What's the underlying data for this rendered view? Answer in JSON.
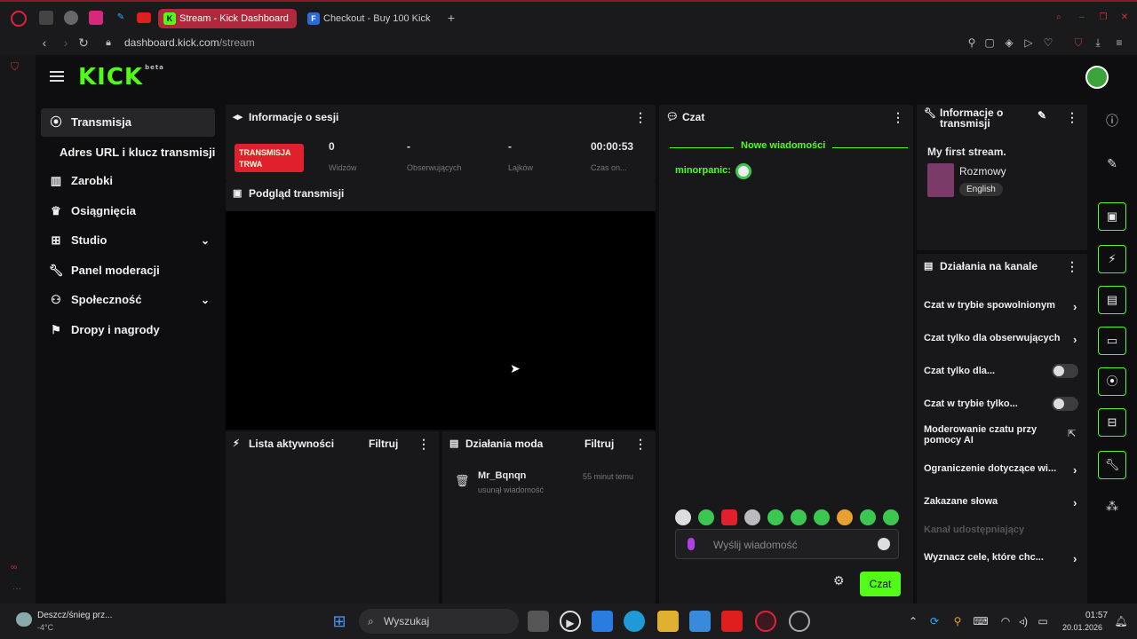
{
  "browser": {
    "tabs": [
      {
        "title": "Stream - Kick Dashboard",
        "active": true
      },
      {
        "title": "Checkout - Buy 100 Kick",
        "active": false
      }
    ],
    "url_host": "dashboard.kick.com",
    "url_path": "/stream"
  },
  "brand": {
    "logo": "KICK",
    "logo_sup": "beta",
    "accent": "#53fc18"
  },
  "sidebar": {
    "items": [
      {
        "label": "Transmisja",
        "icon": "broadcast-icon",
        "active": true
      },
      {
        "label": "Zarobki",
        "icon": "chart-icon"
      },
      {
        "label": "Osiągnięcia",
        "icon": "trophy-icon"
      },
      {
        "label": "Studio",
        "icon": "studio-icon",
        "expandable": true
      },
      {
        "label": "Panel moderacji",
        "icon": "wrench-icon"
      },
      {
        "label": "Społeczność",
        "icon": "community-icon",
        "expandable": true
      },
      {
        "label": "Dropy i nagrody",
        "icon": "gift-icon"
      }
    ],
    "sub_item": "Adres URL i klucz transmisji"
  },
  "session": {
    "title": "Informacje o sesji",
    "badge": "TRANSMISJA TRWA",
    "stats": [
      {
        "value": "0",
        "label": "Widzów"
      },
      {
        "value": "-",
        "label": "Obserwujących"
      },
      {
        "value": "-",
        "label": "Lajków"
      },
      {
        "value": "00:00:53",
        "label": "Czas on..."
      }
    ]
  },
  "preview": {
    "title": "Podgląd transmisji"
  },
  "activity": {
    "title": "Lista aktywności",
    "filter": "Filtruj"
  },
  "mod": {
    "title": "Działania moda",
    "filter": "Filtruj",
    "entry_user": "Mr_Bqnqn",
    "entry_action": "usunął wiadomość",
    "entry_time": "55 minut temu"
  },
  "chat": {
    "title": "Czat",
    "new_messages": "Nowe wiadomości",
    "user": "minorpanic:",
    "input_placeholder": "Wyślij wiadomość",
    "send": "Czat"
  },
  "stream_info": {
    "title": "Informacje o transmisji",
    "stream_title": "My first stream.",
    "category": "Rozmowy",
    "language": "English"
  },
  "channel_actions": {
    "title": "Działania na kanale",
    "items": [
      {
        "label": "Czat w trybie spowolnionym",
        "kind": "arrow"
      },
      {
        "label": "Czat tylko dla obserwujących",
        "kind": "arrow"
      },
      {
        "label": "Czat tylko dla...",
        "kind": "toggle"
      },
      {
        "label": "Czat w trybie tylko...",
        "kind": "toggle"
      },
      {
        "label": "Moderowanie czatu przy pomocy AI",
        "kind": "external"
      },
      {
        "label": "Ograniczenie dotyczące wi...",
        "kind": "arrow"
      },
      {
        "label": "Zakazane słowa",
        "kind": "arrow"
      },
      {
        "label": "Kanał udostępniający",
        "kind": "muted"
      },
      {
        "label": "Wyznacz cele, które chc...",
        "kind": "arrow"
      }
    ]
  },
  "taskbar": {
    "weather": "Deszcz/śnieg prz...",
    "temp": "-4°C",
    "search": "Wyszukaj",
    "time": "01:57",
    "date": "20.01.2026"
  }
}
